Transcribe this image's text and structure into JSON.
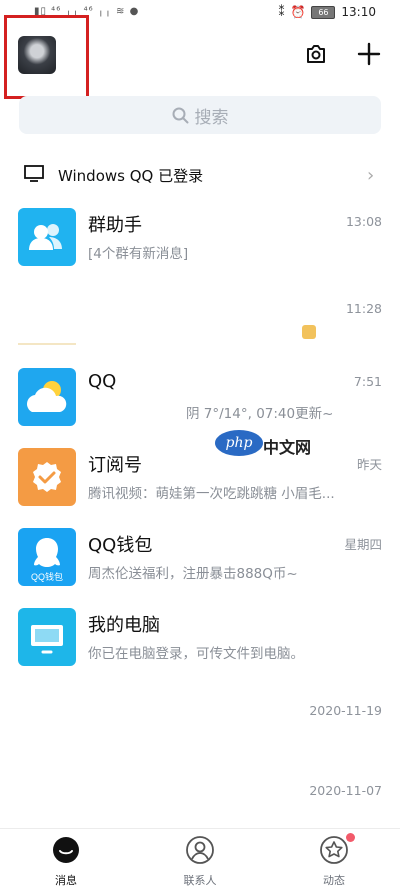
{
  "statusbar": {
    "left_icons": "▮▯ ⁴⁶ ╷╷ ⁴⁶ ╷╷ ≋ ●",
    "battery": "66",
    "time": "13:10"
  },
  "header": {
    "search_placeholder": "搜索"
  },
  "device_notice": {
    "text": "Windows QQ 已登录"
  },
  "chats": [
    {
      "name": "群助手",
      "preview": "[4个群有新消息]",
      "time": "13:08",
      "icon": "group-helper-icon",
      "color": "#20b3f0"
    },
    {
      "name": "",
      "preview": "",
      "time": "11:28",
      "icon": "",
      "color": ""
    },
    {
      "name": "QQ",
      "preview": "阴 7°/14°, 07:40更新~",
      "time": "7:51",
      "icon": "weather-icon",
      "color": "#1fa7ef"
    },
    {
      "name": "订阅号",
      "preview": "腾讯视频：萌娃第一次吃跳跳糖 小眉毛...",
      "time": "昨天",
      "icon": "subscription-icon",
      "color": "#f49b44"
    },
    {
      "name": "QQ钱包",
      "preview": "周杰伦送福利，注册暴击888Q币~",
      "time": "星期四",
      "icon": "wallet-icon",
      "color": "#1aa3f2"
    },
    {
      "name": "我的电脑",
      "preview": "你已在电脑登录，可传文件到电脑。",
      "time": "",
      "icon": "computer-icon",
      "color": "#1eb6e9"
    },
    {
      "name": "",
      "preview": "",
      "time": "2020-11-19",
      "icon": "",
      "color": ""
    },
    {
      "name": "",
      "preview": "",
      "time": "2020-11-07",
      "icon": "",
      "color": ""
    }
  ],
  "watermark": {
    "logo": "php",
    "text": "中文网"
  },
  "tabs": [
    {
      "label": "消息",
      "icon": "messages-icon"
    },
    {
      "label": "联系人",
      "icon": "contacts-icon"
    },
    {
      "label": "动态",
      "icon": "moments-icon"
    }
  ]
}
